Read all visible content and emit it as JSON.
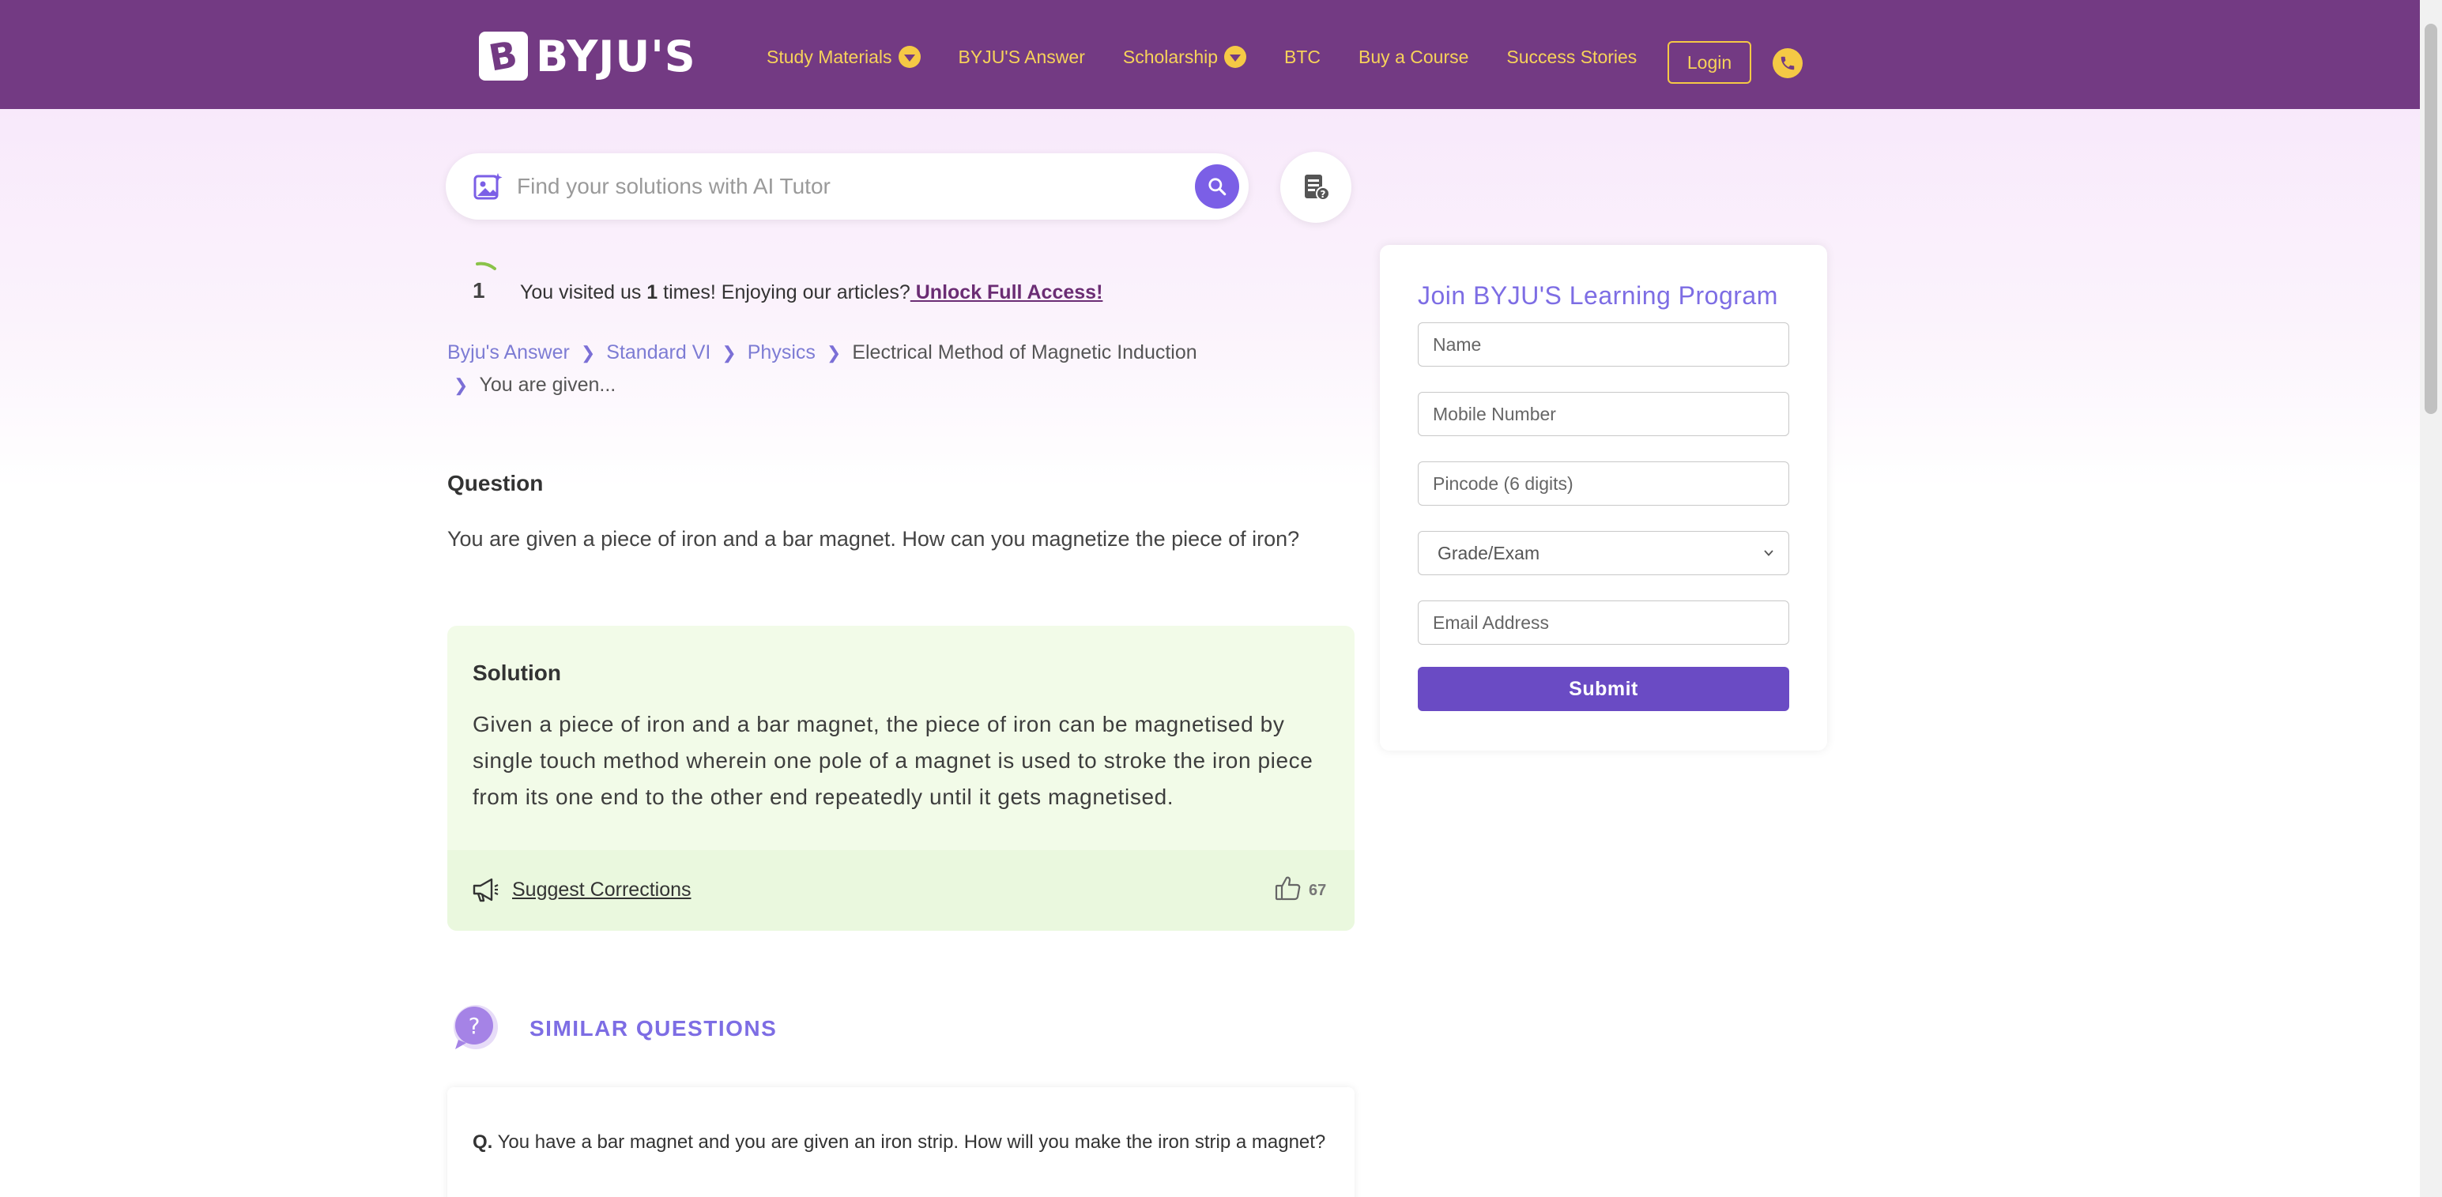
{
  "header": {
    "logo_letter": "B",
    "logo_text": "BYJU'S",
    "nav": [
      {
        "label": "Study Materials",
        "has_dropdown": true
      },
      {
        "label": "BYJU'S Answer",
        "has_dropdown": false
      },
      {
        "label": "Scholarship",
        "has_dropdown": true
      },
      {
        "label": "BTC",
        "has_dropdown": false
      },
      {
        "label": "Buy a Course",
        "has_dropdown": false
      },
      {
        "label": "Success Stories",
        "has_dropdown": false
      }
    ],
    "login_label": "Login",
    "phone_icon": "phone-icon",
    "colors": {
      "bar": "#733a83",
      "accent": "#f5c945"
    }
  },
  "search": {
    "placeholder": "Find your solutions with AI Tutor",
    "ai_icon": "ai-image-search-icon",
    "button_icon": "search-icon",
    "doc_button_icon": "document-help-icon"
  },
  "visit": {
    "count": "1",
    "text_before": "You visited us ",
    "count_inline": "1",
    "text_after": " times! Enjoying our articles?",
    "unlock_label": " Unlock Full Access!"
  },
  "breadcrumb": {
    "links": [
      "Byju's Answer",
      "Standard VI",
      "Physics"
    ],
    "topic": "Electrical Method of Magnetic Induction",
    "current": "You are given..."
  },
  "question": {
    "heading": "Question",
    "text": "You are given a piece of iron and a bar magnet. How can you magnetize the piece of iron?"
  },
  "solution": {
    "heading": "Solution",
    "text": "Given a piece of iron and a bar magnet, the piece of iron can be magnetised by single touch method wherein one pole of a magnet is used to stroke the iron piece from its one end to the other end repeatedly until it gets magnetised.",
    "suggest_label": "Suggest Corrections",
    "likes": "67"
  },
  "similar": {
    "title": "SIMILAR QUESTIONS",
    "items": [
      {
        "prefix": "Q.",
        "text": " You have a bar magnet and you are given an iron strip. How will you make the iron strip a magnet?"
      }
    ]
  },
  "form": {
    "title": "Join BYJU'S Learning Program",
    "name_placeholder": "Name",
    "mobile_placeholder": "Mobile Number",
    "pincode_placeholder": "Pincode (6 digits)",
    "grade_selected": "Grade/Exam",
    "email_placeholder": "Email Address",
    "submit_label": "Submit"
  }
}
